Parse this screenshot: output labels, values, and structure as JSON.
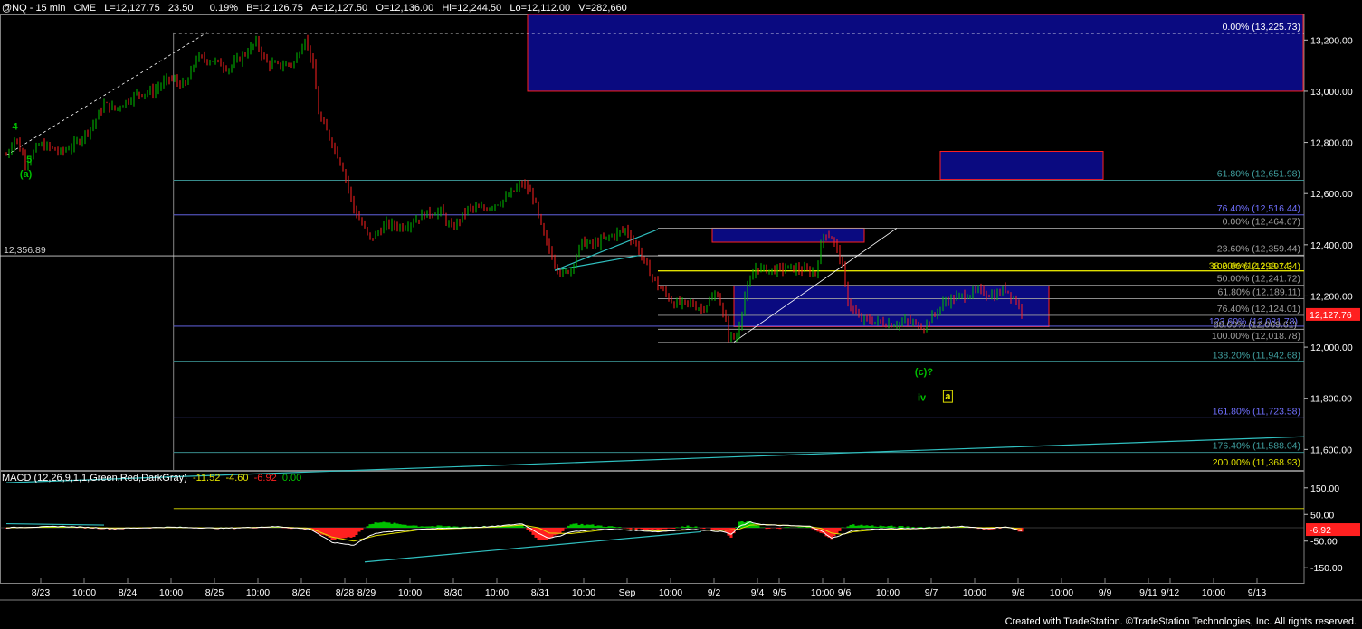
{
  "header": {
    "symbol": "@NQ - 15 min",
    "exchange": "CME",
    "last": "L=12,127.75",
    "change": "23.50",
    "pct": "0.19%",
    "bid": "B=12,126.75",
    "ask": "A=12,127.50",
    "open": "O=12,136.00",
    "high": "Hi=12,244.50",
    "low": "Lo=12,112.00",
    "volume": "V=282,660"
  },
  "macd_header": {
    "label": "MACD (12,26,9,1,1,Green,Red,DarkGray)",
    "macd": "-11.52",
    "signal": "-4.60",
    "hist": "-6.92",
    "zero": "0.00"
  },
  "footer": {
    "text": "Created with TradeStation. ©TradeStation Technologies, Inc. All rights reserved."
  },
  "colors": {
    "background": "#000000",
    "up_bar": "#00c000",
    "down_bar": "#ff2020",
    "zone_fill": "#0a0a80",
    "zone_border": "#ff2020",
    "fib_blue": "#7070ff",
    "fib_teal": "#40a0a0",
    "fib_gray": "#a0a0a0",
    "trendline": "#30c0c0",
    "label_green": "#00c000",
    "label_yellow": "#e0e000",
    "price_marker": "#ff2020"
  },
  "chart_data": {
    "type": "candlestick",
    "title": "",
    "y_axis": {
      "ticks": [
        "13,200.00",
        "13,000.00",
        "12,800.00",
        "12,600.00",
        "12,400.00",
        "12,200.00",
        "12,000.00",
        "11,800.00",
        "11,600.00"
      ],
      "tick_values": [
        13200,
        13000,
        12800,
        12600,
        12400,
        12200,
        12000,
        11800,
        11600
      ],
      "range": [
        11520,
        13300
      ],
      "last_price_label": "12,127.76",
      "last_price_value": 12127.76
    },
    "x_axis": {
      "labels": [
        "8/23",
        "10:00",
        "8/24",
        "10:00",
        "8/25",
        "10:00",
        "8/26",
        "8/28",
        "8/29",
        "10:00",
        "8/30",
        "10:00",
        "8/31",
        "10:00",
        "Sep",
        "10:00",
        "9/2",
        "9/4",
        "9/5",
        "10:00",
        "9/6",
        "10:00",
        "9/7",
        "10:00",
        "9/8",
        "10:00",
        "9/9",
        "9/11",
        "9/12",
        "10:00",
        "9/13"
      ],
      "index": [
        0,
        4,
        8,
        12,
        16,
        20,
        24,
        28,
        30,
        34,
        38,
        42,
        46,
        50,
        54,
        58,
        62,
        66,
        68,
        72,
        74,
        78,
        82,
        86,
        90,
        94,
        98,
        102,
        104,
        108,
        112
      ]
    },
    "reference_line": {
      "label": "12,356.89",
      "value": 12356.89
    },
    "fib_levels": [
      {
        "label": "0.00% (13,225.73)",
        "value": 13225.73,
        "style": "dash"
      },
      {
        "label": "61.80% (12,651.98)",
        "value": 12651.98,
        "style": "teal"
      },
      {
        "label": "76.40% (12,516.44)",
        "value": 12516.44,
        "style": "blue"
      },
      {
        "label": "0.00% (12,464.67)",
        "value": 12464.67,
        "style": "gray"
      },
      {
        "label": "23.60% (12,359.44)",
        "value": 12359.44,
        "style": "gray"
      },
      {
        "label": "100.00% (12,297.34)",
        "value": 12297.34,
        "style": "yellow"
      },
      {
        "label": "38.20% (12,299.14)",
        "value": 12299.14,
        "style": "yellow"
      },
      {
        "label": "50.00% (12,241.72)",
        "value": 12241.72,
        "style": "gray"
      },
      {
        "label": "61.80% (12,189.11)",
        "value": 12189.11,
        "style": "gray"
      },
      {
        "label": "76.40% (12,124.01)",
        "value": 12124.01,
        "style": "gray"
      },
      {
        "label": "123.60% (12,081.78)",
        "value": 12081.78,
        "style": "blue"
      },
      {
        "label": "88.60% (12,069.61)",
        "value": 12069.61,
        "style": "gray"
      },
      {
        "label": "100.00% (12,018.78)",
        "value": 12018.78,
        "style": "gray"
      },
      {
        "label": "138.20% (11,942.68)",
        "value": 11942.68,
        "style": "teal"
      },
      {
        "label": "161.80% (11,723.58)",
        "value": 11723.58,
        "style": "blue"
      },
      {
        "label": "176.40% (11,588.04)",
        "value": 11588.04,
        "style": "teal"
      },
      {
        "label": "200.00% (11,368.93)",
        "value": 11368.93,
        "style": "yellow"
      }
    ],
    "zones": [
      {
        "from_index": 48,
        "to_index": 132,
        "low": 13000,
        "high": 13300
      },
      {
        "from_index": 86,
        "to_index": 101,
        "low": 12655,
        "high": 12765
      },
      {
        "from_index": 65,
        "to_index": 79,
        "low": 12410,
        "high": 12465
      },
      {
        "from_index": 67,
        "to_index": 96,
        "low": 12080,
        "high": 12240
      }
    ],
    "wave_labels": [
      {
        "text": "4",
        "index": 0.8,
        "value": 12850,
        "color": "green"
      },
      {
        "text": "5",
        "index": 2.1,
        "value": 12720,
        "color": "green"
      },
      {
        "text": "(a)",
        "index": 1.8,
        "value": 12665,
        "color": "green"
      },
      {
        "text": "(c)?",
        "index": 84.5,
        "value": 11890,
        "color": "green"
      },
      {
        "text": "iv",
        "index": 84.3,
        "value": 11790,
        "color": "green"
      },
      {
        "text": "a",
        "index": 86.7,
        "value": 11795,
        "color": "yellow_box"
      }
    ],
    "price_path": [
      [
        0,
        12750
      ],
      [
        0.8,
        12820
      ],
      [
        1.8,
        12720
      ],
      [
        3,
        12790
      ],
      [
        4,
        12780
      ],
      [
        5,
        12760
      ],
      [
        6.5,
        12800
      ],
      [
        8,
        12870
      ],
      [
        9,
        12950
      ],
      [
        10,
        12930
      ],
      [
        12,
        12990
      ],
      [
        13.5,
        13000
      ],
      [
        15,
        13050
      ],
      [
        16.5,
        13020
      ],
      [
        17.5,
        13130
      ],
      [
        19,
        13120
      ],
      [
        20.5,
        13090
      ],
      [
        21.8,
        13140
      ],
      [
        23,
        13190
      ],
      [
        24,
        13110
      ],
      [
        25,
        13100
      ],
      [
        26.5,
        13110
      ],
      [
        27.5,
        13210
      ],
      [
        28.2,
        13110
      ],
      [
        28.8,
        12900
      ],
      [
        30,
        12800
      ],
      [
        31,
        12700
      ],
      [
        32,
        12540
      ],
      [
        33.5,
        12420
      ],
      [
        35,
        12480
      ],
      [
        36.5,
        12470
      ],
      [
        38.5,
        12520
      ],
      [
        40,
        12530
      ],
      [
        41,
        12460
      ],
      [
        42.5,
        12540
      ],
      [
        44,
        12540
      ],
      [
        46,
        12580
      ],
      [
        47.5,
        12640
      ],
      [
        48.5,
        12590
      ],
      [
        49.5,
        12430
      ],
      [
        50.5,
        12330
      ],
      [
        51.2,
        12280
      ],
      [
        52,
        12310
      ],
      [
        53,
        12410
      ],
      [
        54,
        12400
      ],
      [
        55.5,
        12430
      ],
      [
        57,
        12460
      ],
      [
        58,
        12400
      ],
      [
        59,
        12310
      ],
      [
        60,
        12240
      ],
      [
        61.5,
        12170
      ],
      [
        63,
        12170
      ],
      [
        64,
        12150
      ],
      [
        65.5,
        12210
      ],
      [
        66.5,
        12050
      ],
      [
        67.2,
        12030
      ],
      [
        68,
        12200
      ],
      [
        69,
        12310
      ],
      [
        70.5,
        12300
      ],
      [
        72,
        12310
      ],
      [
        73.5,
        12300
      ],
      [
        74.5,
        12290
      ],
      [
        75.3,
        12450
      ],
      [
        76,
        12430
      ],
      [
        76.8,
        12350
      ],
      [
        77.5,
        12180
      ],
      [
        78.5,
        12110
      ],
      [
        80,
        12100
      ],
      [
        81.5,
        12090
      ],
      [
        83,
        12100
      ],
      [
        84.5,
        12080
      ],
      [
        85.5,
        12130
      ],
      [
        86.5,
        12180
      ],
      [
        88,
        12200
      ],
      [
        89.5,
        12220
      ],
      [
        91,
        12200
      ],
      [
        92,
        12230
      ],
      [
        93,
        12180
      ],
      [
        93.6,
        12128
      ]
    ],
    "trend_lines": [
      {
        "from": [
          0,
          12750
        ],
        "to": [
          18.5,
          13230
        ],
        "style": "dash_white"
      },
      {
        "from": [
          0,
          11470
        ],
        "to": [
          132,
          11650
        ],
        "style": "teal"
      },
      {
        "from": [
          50.5,
          12300
        ],
        "to": [
          60,
          12460
        ],
        "style": "teal"
      },
      {
        "from": [
          50.5,
          12300
        ],
        "to": [
          58.5,
          12360
        ],
        "style": "teal"
      },
      {
        "from": [
          67,
          12020
        ],
        "to": [
          82,
          12465
        ],
        "style": "white"
      }
    ],
    "macd": {
      "y_ticks": [
        "150.00",
        "50.00",
        "-50.00",
        "-150.00"
      ],
      "y_tick_values": [
        150,
        50,
        -50,
        -150
      ],
      "range": [
        -190,
        190
      ],
      "last_label": "-6.92",
      "last_value": -6.92,
      "macd_line": [
        [
          0,
          0
        ],
        [
          5,
          5
        ],
        [
          10,
          -3
        ],
        [
          15,
          2
        ],
        [
          20,
          -2
        ],
        [
          25,
          4
        ],
        [
          28,
          -5
        ],
        [
          30,
          -55
        ],
        [
          32,
          -65
        ],
        [
          33,
          -40
        ],
        [
          34,
          -20
        ],
        [
          38,
          -5
        ],
        [
          42,
          0
        ],
        [
          45,
          5
        ],
        [
          47.5,
          15
        ],
        [
          49,
          -20
        ],
        [
          50,
          -40
        ],
        [
          51,
          -30
        ],
        [
          52,
          -15
        ],
        [
          55,
          -5
        ],
        [
          58,
          -10
        ],
        [
          60,
          -15
        ],
        [
          63,
          -5
        ],
        [
          66,
          -15
        ],
        [
          66.8,
          -25
        ],
        [
          67.5,
          5
        ],
        [
          68.5,
          20
        ],
        [
          70,
          10
        ],
        [
          72,
          8
        ],
        [
          74,
          5
        ],
        [
          75,
          -10
        ],
        [
          76,
          -40
        ],
        [
          77,
          -25
        ],
        [
          78,
          -10
        ],
        [
          80,
          -5
        ],
        [
          84,
          -2
        ],
        [
          88,
          5
        ],
        [
          90,
          -3
        ],
        [
          92,
          3
        ],
        [
          93.6,
          -11.52
        ]
      ],
      "signal_line": [
        [
          0,
          0
        ],
        [
          5,
          3
        ],
        [
          10,
          -1
        ],
        [
          15,
          1
        ],
        [
          20,
          -1
        ],
        [
          25,
          3
        ],
        [
          28,
          -2
        ],
        [
          30,
          -35
        ],
        [
          32,
          -50
        ],
        [
          34,
          -30
        ],
        [
          38,
          -8
        ],
        [
          42,
          -2
        ],
        [
          45,
          3
        ],
        [
          47.5,
          10
        ],
        [
          49,
          0
        ],
        [
          50,
          -20
        ],
        [
          52,
          -22
        ],
        [
          55,
          -8
        ],
        [
          58,
          -8
        ],
        [
          60,
          -12
        ],
        [
          63,
          -8
        ],
        [
          66,
          -10
        ],
        [
          67.5,
          -5
        ],
        [
          68.5,
          10
        ],
        [
          70,
          12
        ],
        [
          72,
          8
        ],
        [
          74,
          4
        ],
        [
          75,
          -2
        ],
        [
          76,
          -20
        ],
        [
          77,
          -25
        ],
        [
          78,
          -15
        ],
        [
          80,
          -8
        ],
        [
          84,
          -3
        ],
        [
          88,
          3
        ],
        [
          90,
          0
        ],
        [
          92,
          2
        ],
        [
          93.6,
          -4.6
        ]
      ],
      "trend_lines": [
        {
          "from": [
            0,
            15
          ],
          "to": [
            9,
            10
          ]
        },
        {
          "from": [
            33,
            -128
          ],
          "to": [
            64,
            -15
          ]
        }
      ]
    }
  }
}
